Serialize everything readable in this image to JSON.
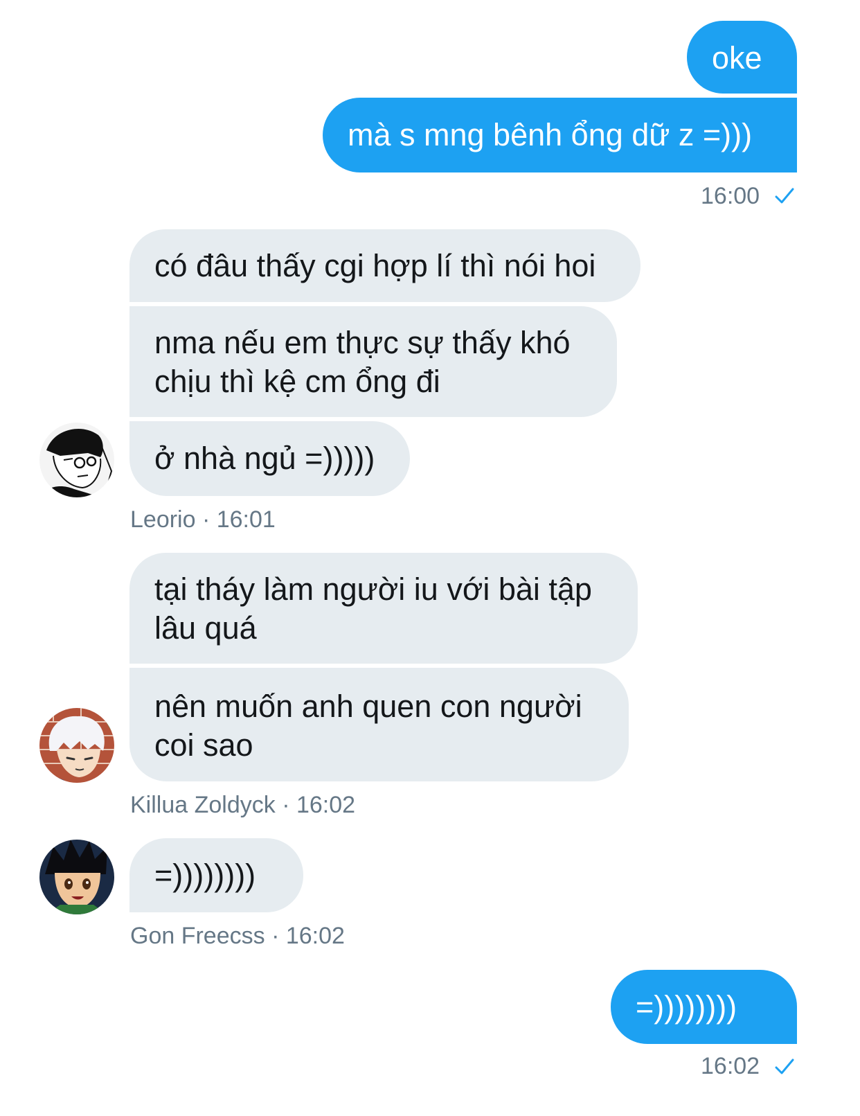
{
  "colors": {
    "outgoing_bubble": "#1da1f2",
    "incoming_bubble": "#e6ecf0",
    "meta_text": "#657786",
    "check": "#1da1f2"
  },
  "conversation": {
    "groups": [
      {
        "direction": "outgoing",
        "messages": [
          "oke",
          "mà s mng bênh ổng dữ z =)))"
        ],
        "time": "16:00",
        "status_icon": "check-icon"
      },
      {
        "direction": "incoming",
        "sender": "Leorio",
        "separator": " · ",
        "time": "16:01",
        "avatar_icon": "leorio-avatar",
        "messages": [
          "có đâu thấy cgi hợp lí thì nói hoi",
          "nma nếu em thực sự thấy khó\nchịu thì kệ cm ổng đi",
          "ở nhà ngủ =)))))"
        ]
      },
      {
        "direction": "incoming",
        "sender": "Killua Zoldyck",
        "separator": " · ",
        "time": "16:02",
        "avatar_icon": "killua-avatar",
        "messages": [
          "tại tháy làm người iu với bài tập\nlâu quá",
          "nên muốn anh quen con người\ncoi sao"
        ]
      },
      {
        "direction": "incoming",
        "sender": "Gon Freecss",
        "separator": " · ",
        "time": "16:02",
        "avatar_icon": "gon-avatar",
        "messages": [
          "=))))))))"
        ]
      },
      {
        "direction": "outgoing",
        "messages": [
          "=))))))))"
        ],
        "time": "16:02",
        "status_icon": "check-icon"
      }
    ]
  }
}
